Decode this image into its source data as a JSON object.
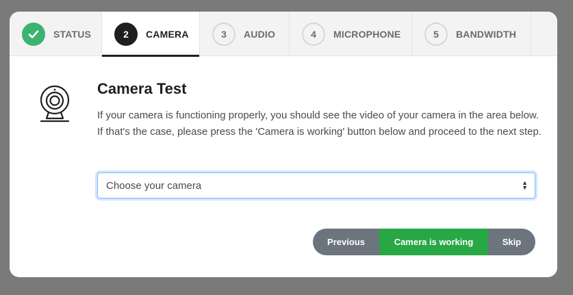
{
  "tabs": [
    {
      "num": "",
      "label": "STATUS",
      "state": "done"
    },
    {
      "num": "2",
      "label": "CAMERA",
      "state": "active"
    },
    {
      "num": "3",
      "label": "AUDIO",
      "state": "pending"
    },
    {
      "num": "4",
      "label": "MICROPHONE",
      "state": "pending"
    },
    {
      "num": "5",
      "label": "BANDWIDTH",
      "state": "pending"
    }
  ],
  "content": {
    "icon": "webcam-icon",
    "title": "Camera Test",
    "description": "If your camera is functioning properly, you should see the video of your camera in the area below. If that's the case, please press the 'Camera is working' button below and proceed to the next step.",
    "camera_select": {
      "value": "Choose your camera"
    }
  },
  "buttons": {
    "previous": "Previous",
    "working": "Camera is working",
    "skip": "Skip"
  },
  "colors": {
    "done": "#3cb371",
    "active": "#1f1f1f",
    "primary_action": "#28a745",
    "secondary_action": "#6c757d"
  }
}
